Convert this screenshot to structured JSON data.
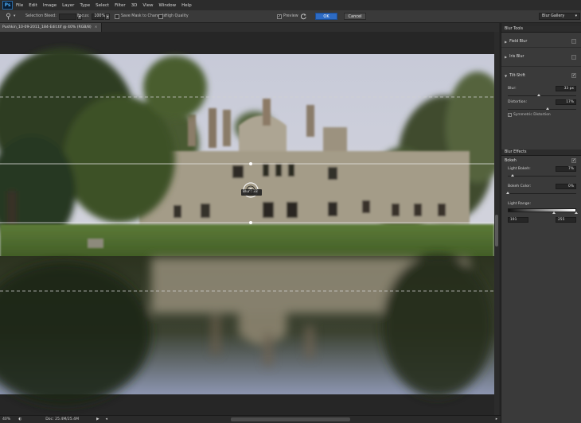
{
  "app": {
    "logo": "Ps"
  },
  "menu": [
    "File",
    "Edit",
    "Image",
    "Layer",
    "Type",
    "Select",
    "Filter",
    "3D",
    "View",
    "Window",
    "Help"
  ],
  "options": {
    "selection_bleed_label": "Selection Bleed:",
    "selection_bleed_value": "",
    "focus_label": "Focus:",
    "focus_value": "100%",
    "save_mask_label": "Save Mask to Channels",
    "high_quality_label": "High Quality",
    "preview_label": "Preview",
    "preview_checked": true,
    "ok_label": "OK",
    "cancel_label": "Cancel",
    "gallery_label": "Blur Gallery"
  },
  "document": {
    "tab_title": "Pushkin_10-09-2011_184-Edit.tif @ 40% (RGB/8)"
  },
  "canvas": {
    "blur_pin_label": "Blur : 33"
  },
  "panel": {
    "blur_tools_title": "Blur Tools",
    "field_blur": "Field Blur",
    "iris_blur": "Iris Blur",
    "tilt_shift": "Tilt-Shift",
    "blur_label": "Blur:",
    "blur_value": "33 px",
    "blur_level": 0.45,
    "distortion_label": "Distortion:",
    "distortion_value": "17%",
    "distortion_level": 0.585,
    "symmetric_label": "Symmetric Distortion",
    "blur_effects_title": "Blur Effects",
    "bokeh_label": "Bokeh",
    "light_bokeh_label": "Light Bokeh:",
    "light_bokeh_value": "7%",
    "light_bokeh_level": 0.07,
    "bokeh_color_label": "Bokeh Color:",
    "bokeh_color_value": "0%",
    "bokeh_color_level": 0.0,
    "light_range_label": "Light Range:",
    "light_range_low": "191",
    "light_range_high": "255"
  },
  "status": {
    "zoom": "40%",
    "doc_size": "Doc: 25.4M/25.4M"
  },
  "colors": {
    "accent": "#2d6bc4",
    "panel": "#3a3a3a",
    "canvas_bg": "#262626"
  }
}
